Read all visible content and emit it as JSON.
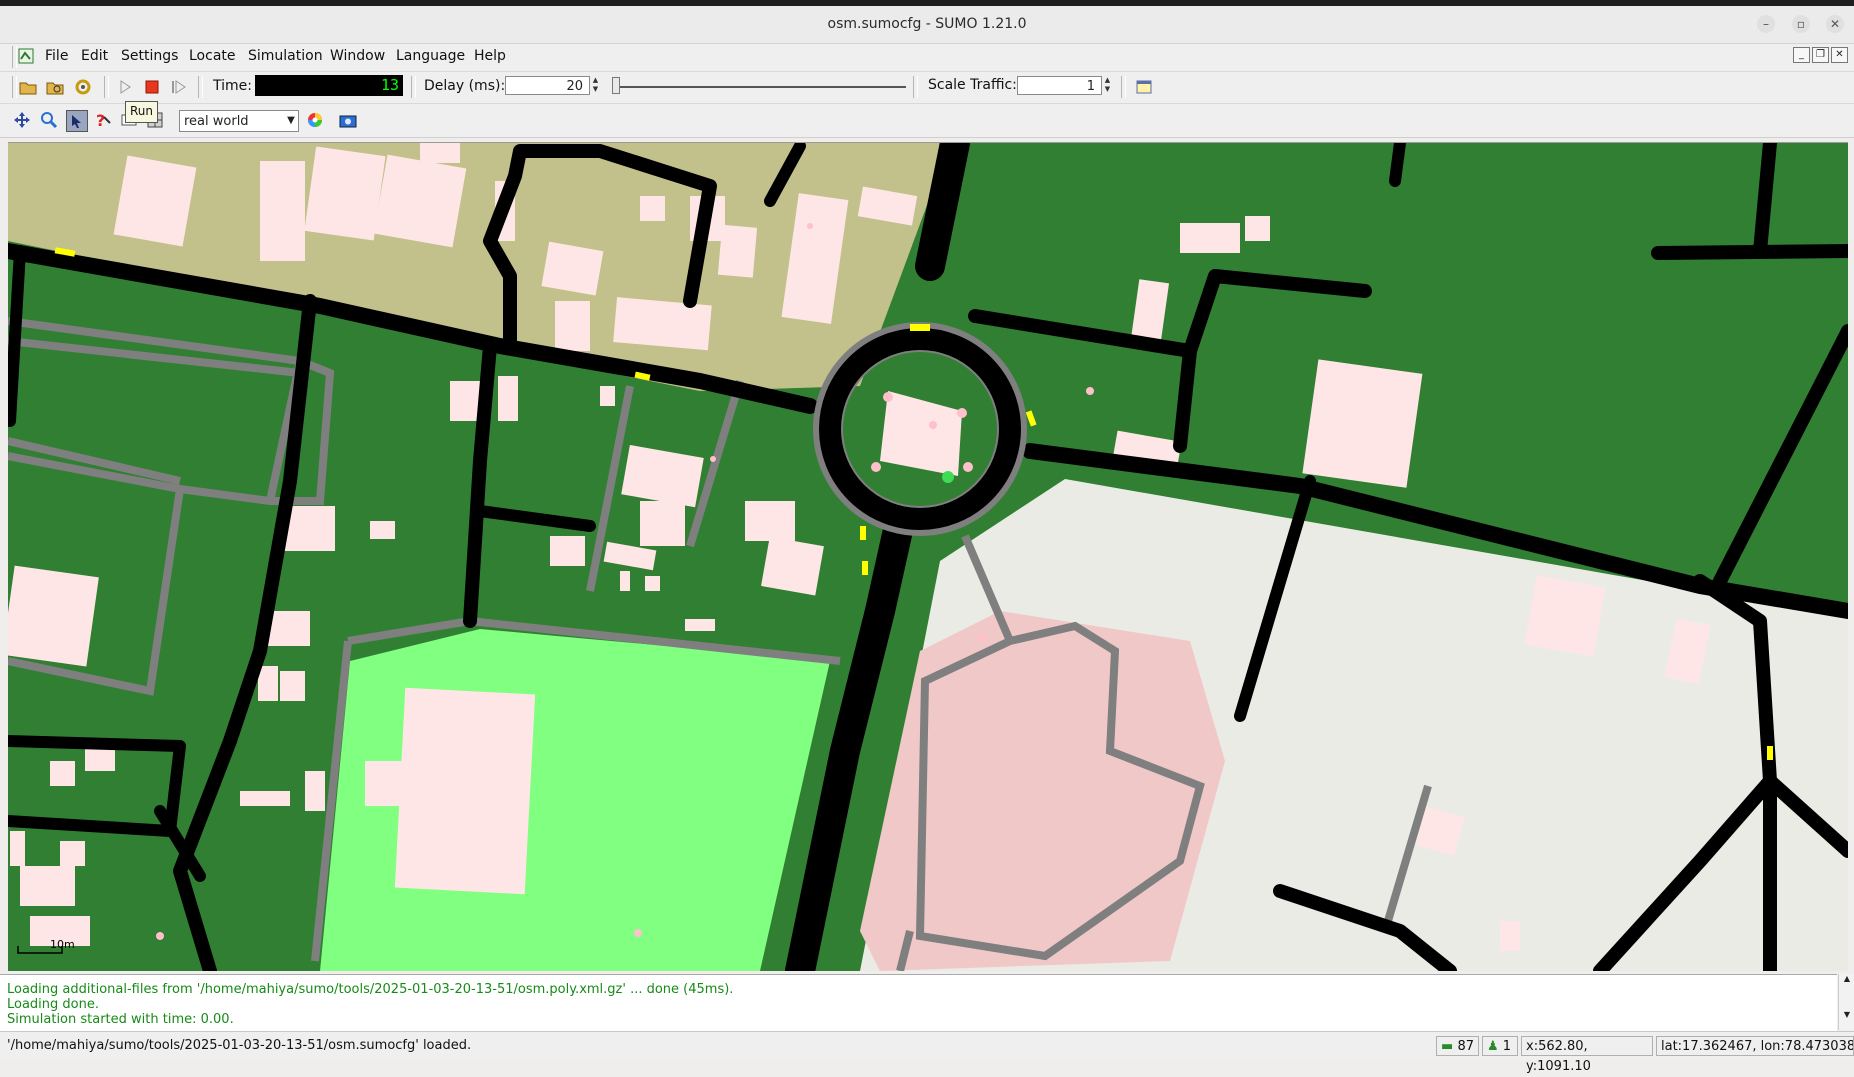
{
  "window": {
    "title": "osm.sumocfg - SUMO 1.21.0",
    "controls": [
      "minimize",
      "restore",
      "close"
    ]
  },
  "menubar": {
    "items": [
      {
        "label": "File",
        "mnemonic": "F"
      },
      {
        "label": "Edit",
        "mnemonic": "E"
      },
      {
        "label": "Settings",
        "mnemonic": "S"
      },
      {
        "label": "Locate",
        "mnemonic": "L"
      },
      {
        "label": "Simulation",
        "mnemonic": "S"
      },
      {
        "label": "Window",
        "mnemonic": "W"
      },
      {
        "label": "Language",
        "mnemonic": "L"
      },
      {
        "label": "Help",
        "mnemonic": "H"
      }
    ]
  },
  "toolbar": {
    "time_label": "Time:",
    "time_value": "13",
    "delay_label": "Delay (ms):",
    "delay_value": "20",
    "delay_slider_fraction": 0.0,
    "scale_label": "Scale Traffic:",
    "scale_value": "1",
    "icons": [
      "open-icon",
      "reload-icon",
      "refresh-icon",
      "run-icon",
      "stop-icon",
      "step-icon",
      "breakpoint-icon"
    ]
  },
  "viewbar": {
    "scheme": "real world",
    "tooltip": "Run",
    "icons": [
      "recenter-icon",
      "zoom-icon",
      "select-icon",
      "inspect-icon",
      "comment-icon",
      "grid-icon",
      "color-wheel-icon",
      "camera-icon"
    ]
  },
  "map": {
    "scale_label": "10m"
  },
  "messages": [
    "Loading additional-files from '/home/mahiya/sumo/tools/2025-01-03-20-13-51/osm.poly.xml.gz' ... done (45ms).",
    "Loading done.",
    "Simulation started with time: 0.00."
  ],
  "statusbar": {
    "message": "'/home/mahiya/sumo/tools/2025-01-03-20-13-51/osm.sumocfg' loaded.",
    "vehicle_count": "87",
    "person_count": "1",
    "coords": "x:562.80, y:1091.10",
    "geo": "lat:17.362467, lon:78.473038"
  },
  "colors": {
    "map_grass": "#317f33",
    "map_park": "#80ff80",
    "map_sand": "#c3c18b",
    "map_building": "#ffe6e6",
    "map_plaza": "#ebebe6",
    "map_commercial": "#f1c8c8",
    "road": "#000000",
    "path": "#808080",
    "vehicle": "#ffff00",
    "message_text": "#178a17"
  }
}
